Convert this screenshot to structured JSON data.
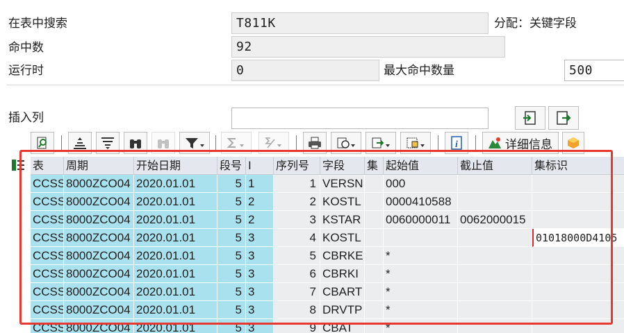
{
  "form": {
    "search_table_label": "在表中搜索",
    "search_table_value": "T811K",
    "assign_label": "分配：关键字段",
    "hit_count_label": "命中数",
    "hit_count_value": "92",
    "runtime_label": "运行时",
    "runtime_value": "0",
    "max_hits_label": "最大命中数量",
    "max_hits_value": "500",
    "insert_col_label": "插入列",
    "insert_col_value": ""
  },
  "toolbar": {
    "details_label": "详细信息",
    "icons": [
      "find-icon",
      "sort-ascending-icon",
      "sort-descending-icon",
      "binoculars-icon",
      "binoculars-next-icon",
      "filter-icon",
      "sum-icon",
      "subtotal-icon",
      "print-icon",
      "views-icon",
      "export-icon",
      "layout-icon",
      "info-icon",
      "details-icon",
      "abc-icon"
    ]
  },
  "table": {
    "columns": [
      "表",
      "周期",
      "开始日期",
      "段号",
      "I",
      "序列号",
      "字段",
      "集",
      "起始值",
      "截止值",
      "集标识"
    ],
    "rows": [
      [
        "CCSS",
        "8000ZCO04",
        "2020.01.01",
        "5",
        "1",
        "1",
        "VERSN",
        "",
        "000",
        "",
        ""
      ],
      [
        "CCSS",
        "8000ZCO04",
        "2020.01.01",
        "5",
        "2",
        "2",
        "KOSTL",
        "",
        "0000410588",
        "",
        ""
      ],
      [
        "CCSS",
        "8000ZCO04",
        "2020.01.01",
        "5",
        "2",
        "3",
        "KSTAR",
        "",
        "0060000011",
        "0062000015",
        ""
      ],
      [
        "CCSS",
        "8000ZCO04",
        "2020.01.01",
        "5",
        "3",
        "4",
        "KOSTL",
        "",
        "",
        "",
        "01018000D4105"
      ],
      [
        "CCSS",
        "8000ZCO04",
        "2020.01.01",
        "5",
        "3",
        "5",
        "CBRKE",
        "",
        "*",
        "",
        ""
      ],
      [
        "CCSS",
        "8000ZCO04",
        "2020.01.01",
        "5",
        "3",
        "6",
        "CBRKI",
        "",
        "*",
        "",
        ""
      ],
      [
        "CCSS",
        "8000ZCO04",
        "2020.01.01",
        "5",
        "3",
        "7",
        "CBART",
        "",
        "*",
        "",
        ""
      ],
      [
        "CCSS",
        "8000ZCO04",
        "2020.01.01",
        "5",
        "3",
        "8",
        "DRVTP",
        "",
        "*",
        "",
        ""
      ],
      [
        "CCSS",
        "8000ZCO04",
        "2020.01.01",
        "5",
        "3",
        "9",
        "CBAT",
        "",
        "*",
        "",
        ""
      ]
    ]
  }
}
